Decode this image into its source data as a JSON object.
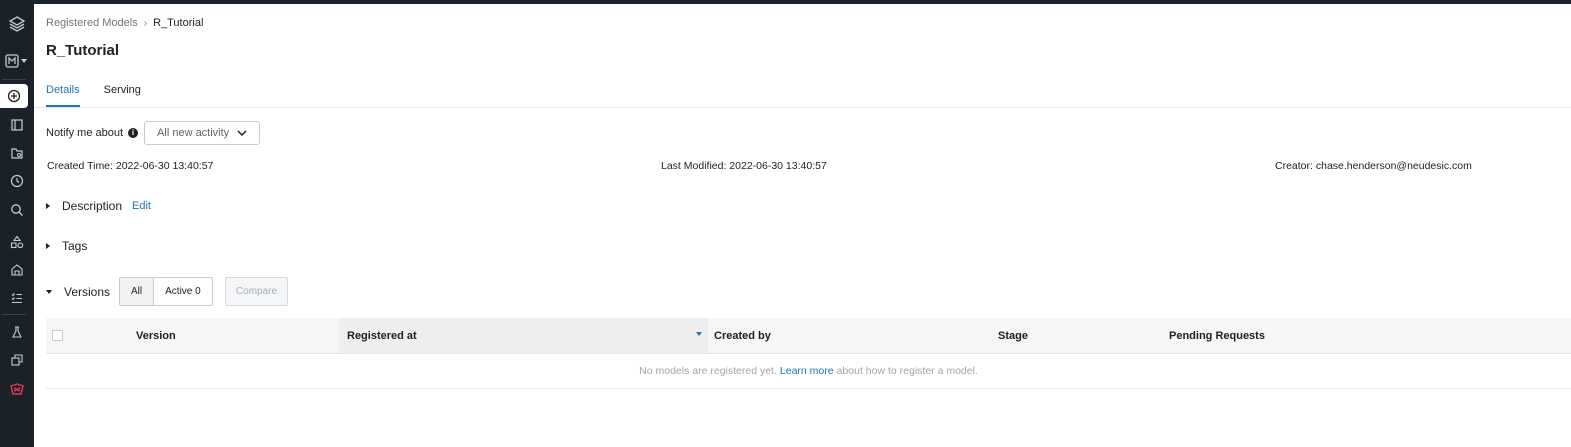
{
  "breadcrumb": {
    "parent": "Registered Models",
    "current": "R_Tutorial"
  },
  "page_title": "R_Tutorial",
  "tabs": [
    {
      "label": "Details",
      "active": true
    },
    {
      "label": "Serving",
      "active": false
    }
  ],
  "notify": {
    "label": "Notify me about",
    "selected": "All new activity"
  },
  "meta": {
    "created_label": "Created Time:",
    "created_value": "2022-06-30 13:40:57",
    "modified_label": "Last Modified:",
    "modified_value": "2022-06-30 13:40:57",
    "creator_label": "Creator:",
    "creator_value": "chase.henderson@neudesic.com"
  },
  "sections": {
    "description": "Description",
    "edit": "Edit",
    "tags": "Tags",
    "versions": "Versions"
  },
  "versions_filter": {
    "all": "All",
    "active": "Active 0",
    "compare": "Compare"
  },
  "table": {
    "columns": [
      "Version",
      "Registered at",
      "Created by",
      "Stage",
      "Pending Requests"
    ],
    "empty_before": "No models are registered yet.",
    "empty_link": "Learn more",
    "empty_after": "about how to register a model."
  },
  "sidebar_icons": [
    "layers-icon",
    "workspace-icon",
    "create-icon",
    "notebook-icon",
    "folder-icon",
    "history-icon",
    "search-icon",
    "shapes-icon",
    "repo-icon",
    "tasks-icon",
    "experiments-icon",
    "models-icon",
    "serving-icon"
  ],
  "colors": {
    "accent": "#2272b4",
    "sidebar": "#1b2128",
    "serving_icon": "#e8365a"
  }
}
